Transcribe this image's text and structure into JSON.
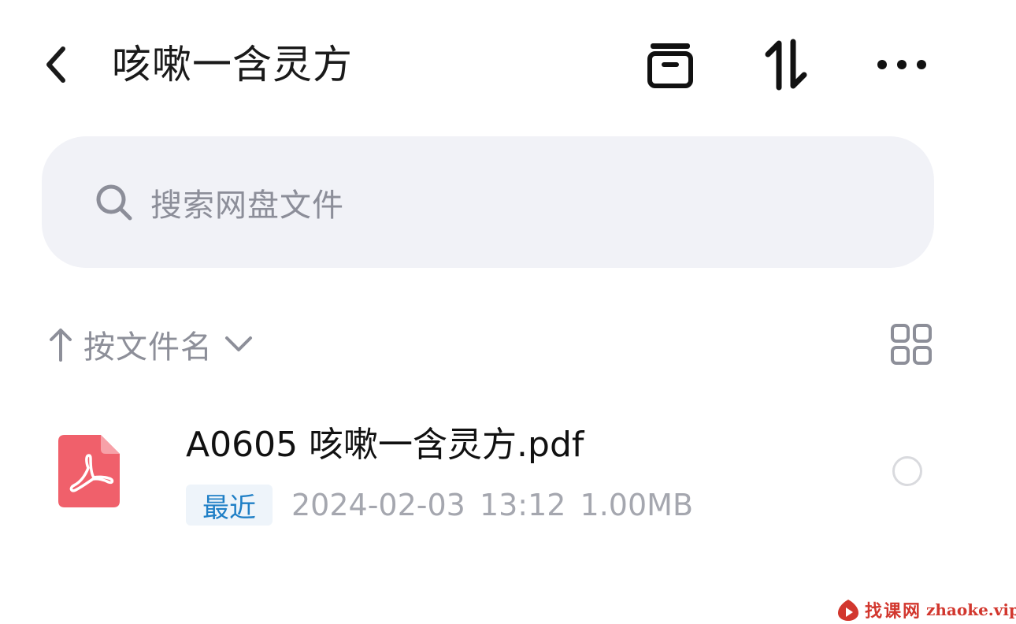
{
  "header": {
    "title": "咳嗽一含灵方",
    "back_icon": "chevron-left-icon",
    "actions": [
      {
        "name": "archive-button",
        "icon": "archive-box-icon"
      },
      {
        "name": "sort-order-button",
        "icon": "up-down-arrows-icon"
      },
      {
        "name": "more-button",
        "icon": "more-dots-icon"
      }
    ]
  },
  "search": {
    "placeholder": "搜索网盘文件"
  },
  "sort": {
    "label": "按文件名",
    "direction_icon": "arrow-up-icon",
    "dropdown_icon": "chevron-down-icon",
    "view_toggle_icon": "grid-view-icon"
  },
  "files": [
    {
      "name": "A0605 咳嗽一含灵方.pdf",
      "badge": "最近",
      "date": "2024-02-03",
      "time": "13:12",
      "size": "1.00MB",
      "type_icon": "pdf-file-icon",
      "selected": false
    }
  ],
  "watermark": {
    "brand_cn": "找课网",
    "brand_url": "zhaoke.vip"
  },
  "colors": {
    "search_bg": "#f1f2f7",
    "muted_text": "#8d8f99",
    "badge_text": "#1f7fc6",
    "badge_bg": "#eef4fa",
    "pdf_red": "#f0606b",
    "watermark_red": "#d2372e"
  }
}
